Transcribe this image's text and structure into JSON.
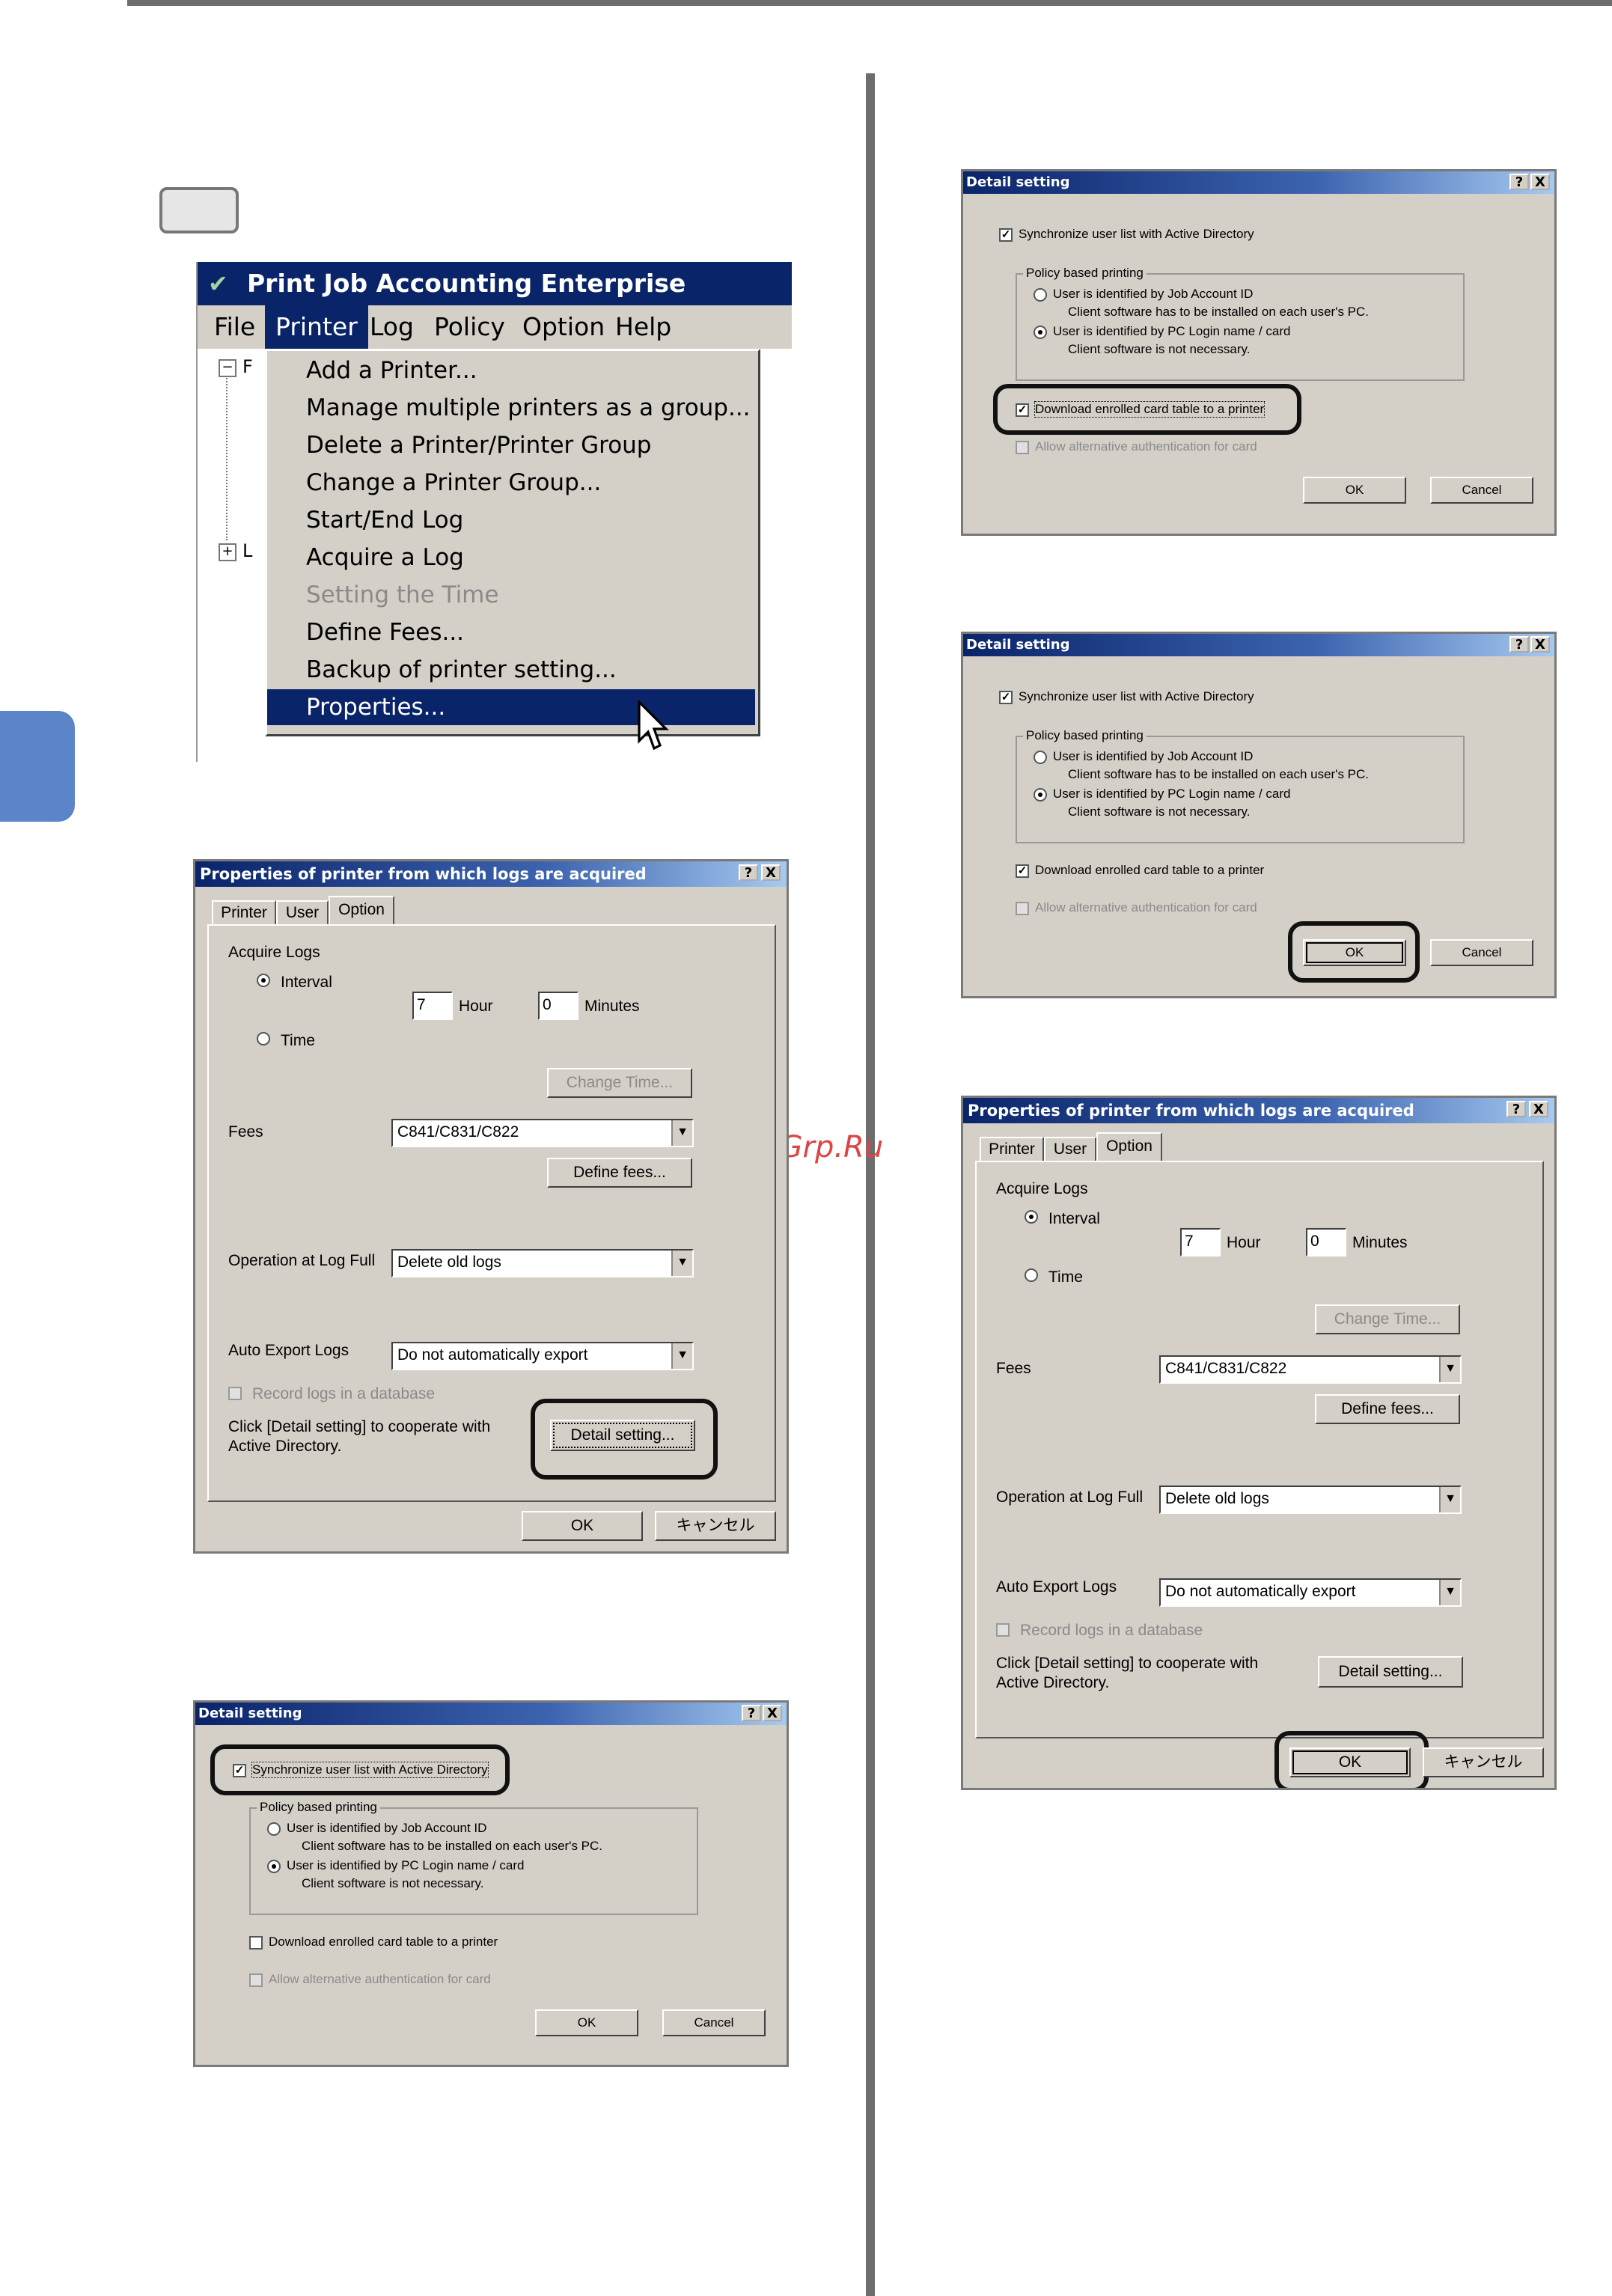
{
  "menu_window": {
    "title": "Print Job Accounting Enterprise",
    "menubar": [
      "File",
      "Printer",
      "Log",
      "Policy",
      "Option",
      "Help"
    ],
    "items": [
      {
        "label": "Add a Printer...",
        "disabled": false
      },
      {
        "label": "Manage multiple printers as a group...",
        "disabled": false
      },
      {
        "label": "Delete a Printer/Printer Group",
        "disabled": false
      },
      {
        "label": "Change a Printer Group...",
        "disabled": false
      },
      {
        "label": "Start/End Log",
        "disabled": false
      },
      {
        "label": "Acquire a Log",
        "disabled": false
      },
      {
        "label": "Setting the Time",
        "disabled": true
      },
      {
        "label": "Define Fees...",
        "disabled": false
      },
      {
        "label": "Backup of printer setting...",
        "disabled": false
      },
      {
        "label": "Properties...",
        "disabled": false,
        "selected": true
      }
    ],
    "tree_nodes": [
      "F",
      "L"
    ]
  },
  "properties_dialog": {
    "title": "Properties of printer from which logs are acquired",
    "help_button": "?",
    "close_button": "X",
    "tabs": [
      "Printer",
      "User",
      "Option"
    ],
    "active_tab": "Option",
    "acquire_logs_label": "Acquire Logs",
    "interval_label": "Interval",
    "hour_value": "7",
    "hour_label": "Hour",
    "minutes_value": "0",
    "minutes_label": "Minutes",
    "time_label": "Time",
    "change_time_button": "Change Time...",
    "fees_label": "Fees",
    "fees_value": "C841/C831/C822",
    "define_fees_button": "Define fees...",
    "operation_label": "Operation at Log Full",
    "operation_value": "Delete old logs",
    "auto_export_label": "Auto Export Logs",
    "auto_export_value": "Do not automatically export",
    "record_db_label": "Record logs in a database",
    "detail_note": "Click [Detail setting] to cooperate with Active Directory.",
    "detail_note_line1": "Click [Detail setting] to cooperate with",
    "detail_note_line2": "Active Directory.",
    "detail_button": "Detail setting...",
    "ok_button": "OK",
    "cancel_button": "キャンセル"
  },
  "detail_dialog": {
    "title": "Detail setting",
    "sync_label": "Synchronize user list with Active Directory",
    "policy_group_label": "Policy based printing",
    "opt_job_account": "User is identified by Job Account ID",
    "opt_job_account_note": "Client software has to be installed on each user's PC.",
    "opt_pc_login": "User is identified by PC Login name / card",
    "opt_pc_login_note": "Client software is not necessary.",
    "download_label": "Download enrolled card table to a printer",
    "alt_auth_label": "Allow alternative authentication for card",
    "ok_button": "OK",
    "cancel_button": "Cancel"
  },
  "watermark": "McGrp.Ru",
  "colors": {
    "titlebar": "#0a246a",
    "dialog_bg": "#d4d0c8",
    "side_tab": "#5b84c9",
    "menu_highlight": "#0a246a"
  }
}
